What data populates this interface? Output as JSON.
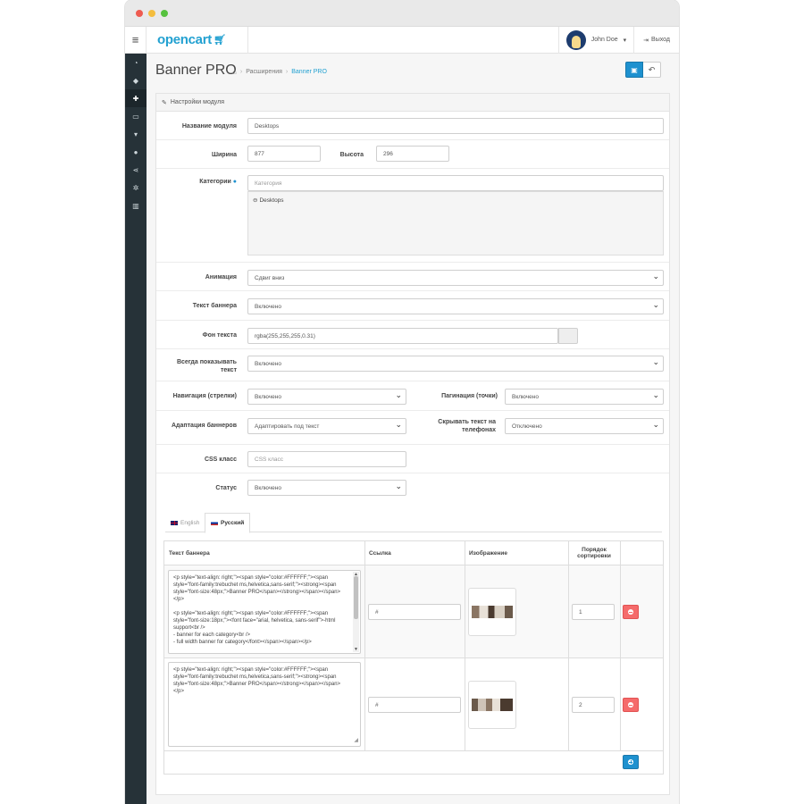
{
  "header": {
    "logo_text": "opencart",
    "user_name": "John Doe",
    "logout_label": "Выход"
  },
  "sidebar": {
    "icons": [
      "dashboard-icon",
      "tags-icon",
      "puzzle-icon",
      "desktop-icon",
      "shopping-cart-icon",
      "user-icon",
      "share-icon",
      "cog-icon",
      "bar-chart-icon"
    ],
    "active_index": 2
  },
  "page": {
    "title": "Banner PRO",
    "breadcrumb": [
      "Расширения",
      "Banner PRO"
    ]
  },
  "panel": {
    "heading": "Настройки модуля"
  },
  "form": {
    "name": {
      "label": "Название модуля",
      "value": "Desktops"
    },
    "width": {
      "label": "Ширина",
      "value": "877"
    },
    "height": {
      "label": "Высота",
      "value": "296"
    },
    "category": {
      "label": "Категории",
      "placeholder": "Категория",
      "selected": [
        "Desktops"
      ]
    },
    "animation": {
      "label": "Анимация",
      "value": "Сдвиг вниз"
    },
    "banner_text": {
      "label": "Текст баннера",
      "value": "Включено"
    },
    "text_bg": {
      "label": "Фон текста",
      "value": "rgba(255,255,255,0.31)"
    },
    "always_show": {
      "label": "Всегда показывать текст",
      "value": "Включено"
    },
    "nav_arrows": {
      "label": "Навигация (стрелки)",
      "value": "Включено"
    },
    "pagination": {
      "label": "Пагинация (точки)",
      "value": "Включено"
    },
    "adaptation": {
      "label": "Адаптация баннеров",
      "value": "Адаптировать под текст"
    },
    "hide_mobile": {
      "label": "Скрывать текст на телефонах",
      "value": "Отключено"
    },
    "css_class": {
      "label": "CSS класс",
      "placeholder": "CSS класс"
    },
    "status": {
      "label": "Статус",
      "value": "Включено"
    }
  },
  "tabs": [
    "English",
    "Русский"
  ],
  "active_tab": 1,
  "banner_table": {
    "headers": [
      "Текст баннера",
      "Ссылка",
      "Изображение",
      "Порядок сортировки"
    ],
    "rows": [
      {
        "text": "<p style=\"text-align: right;\"><span style=\"color:#FFFFFF;\"><span style=\"font-family:trebuchet ms,helvetica,sans-serif;\"><strong><span style=\"font-size:48px;\">Banner PRO</span></strong></span></span></p>\n\n<p style=\"text-align: right;\"><span style=\"color:#FFFFFF;\"><span style=\"font-size:18px;\"><font face=\"arial, helvetica, sans-serif\">-html support<br />\n- banner for each category<br />\n- full width banner for category</font></span></span></p>",
        "link": "#",
        "sort": "1"
      },
      {
        "text": "<p style=\"text-align: right;\"><span style=\"color:#FFFFFF;\"><span style=\"font-family:trebuchet ms,helvetica,sans-serif;\"><strong><span style=\"font-size:48px;\">Banner PRO</span></strong></span></span></p>",
        "link": "#",
        "sort": "2"
      }
    ]
  },
  "colors": {
    "primary": "#1e91cf",
    "danger": "#f56b6b",
    "sidebar": "#263238",
    "logo": "#23a1d1"
  }
}
